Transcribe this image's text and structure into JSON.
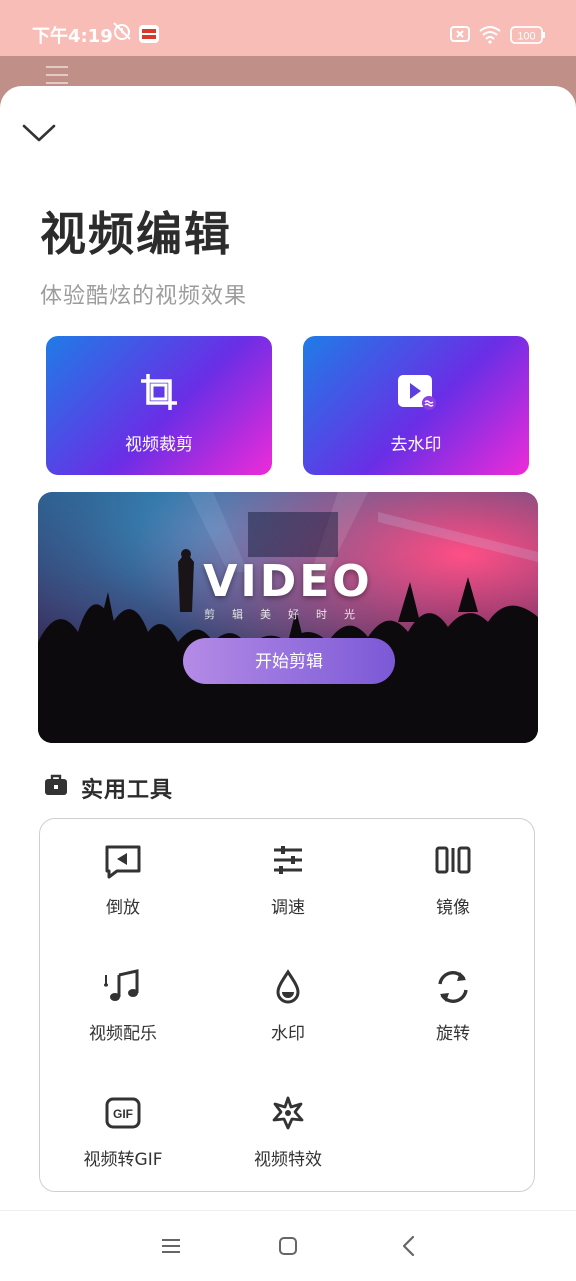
{
  "status_bar": {
    "time": "下午4:19",
    "battery": "100",
    "icons": [
      "alarm-off-icon",
      "news-app-icon",
      "sim-off-icon",
      "wifi-icon",
      "battery-icon"
    ]
  },
  "header": {
    "title": "视频编辑",
    "subtitle": "体验酷炫的视频效果"
  },
  "feature_cards": [
    {
      "label": "视频裁剪",
      "icon": "crop-icon"
    },
    {
      "label": "去水印",
      "icon": "remove-watermark-icon"
    }
  ],
  "banner": {
    "title": "VIDEO",
    "subtitle": "剪辑美好时光",
    "button_label": "开始剪辑"
  },
  "tools_section": {
    "title": "实用工具",
    "icon": "toolbox-icon",
    "items": [
      {
        "label": "倒放",
        "icon": "reverse-play-icon"
      },
      {
        "label": "调速",
        "icon": "speed-sliders-icon"
      },
      {
        "label": "镜像",
        "icon": "mirror-icon"
      },
      {
        "label": "视频配乐",
        "icon": "music-note-icon"
      },
      {
        "label": "水印",
        "icon": "water-drop-icon"
      },
      {
        "label": "旋转",
        "icon": "rotate-icon"
      },
      {
        "label": "视频转GIF",
        "icon": "gif-icon"
      },
      {
        "label": "视频特效",
        "icon": "sparkle-effect-icon"
      }
    ]
  },
  "nav_bar": {
    "buttons": [
      "menu-icon",
      "home-icon",
      "back-icon"
    ]
  },
  "colors": {
    "status_bar": "#f7bdb6",
    "card_gradient_start": "#1f7ce6",
    "card_gradient_end": "#ee2bd8",
    "banner_button": "#9b74de"
  }
}
